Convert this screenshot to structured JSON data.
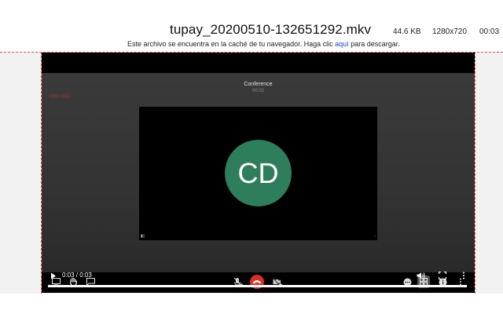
{
  "file": {
    "name": "tupay_20200510-132651292.mkv",
    "size": "44.6 KB",
    "resolution": "1280x720",
    "duration": "00:03"
  },
  "notice": {
    "before": "Este archivo se encuentra en la caché de tu navegador. Haga clic ",
    "link": "aquí",
    "after": " para descargar."
  },
  "video": {
    "conference_title": "Conference",
    "conference_subtitle": "00:02",
    "avatar_initials": "CD",
    "avatar_color": "#2e7d5b"
  },
  "player": {
    "time": "0:03 / 0:03",
    "progress": 1.0
  },
  "colors": {
    "hangup": "#d93025",
    "dashed_border": "#d9534f",
    "link": "#1a3fd0"
  }
}
